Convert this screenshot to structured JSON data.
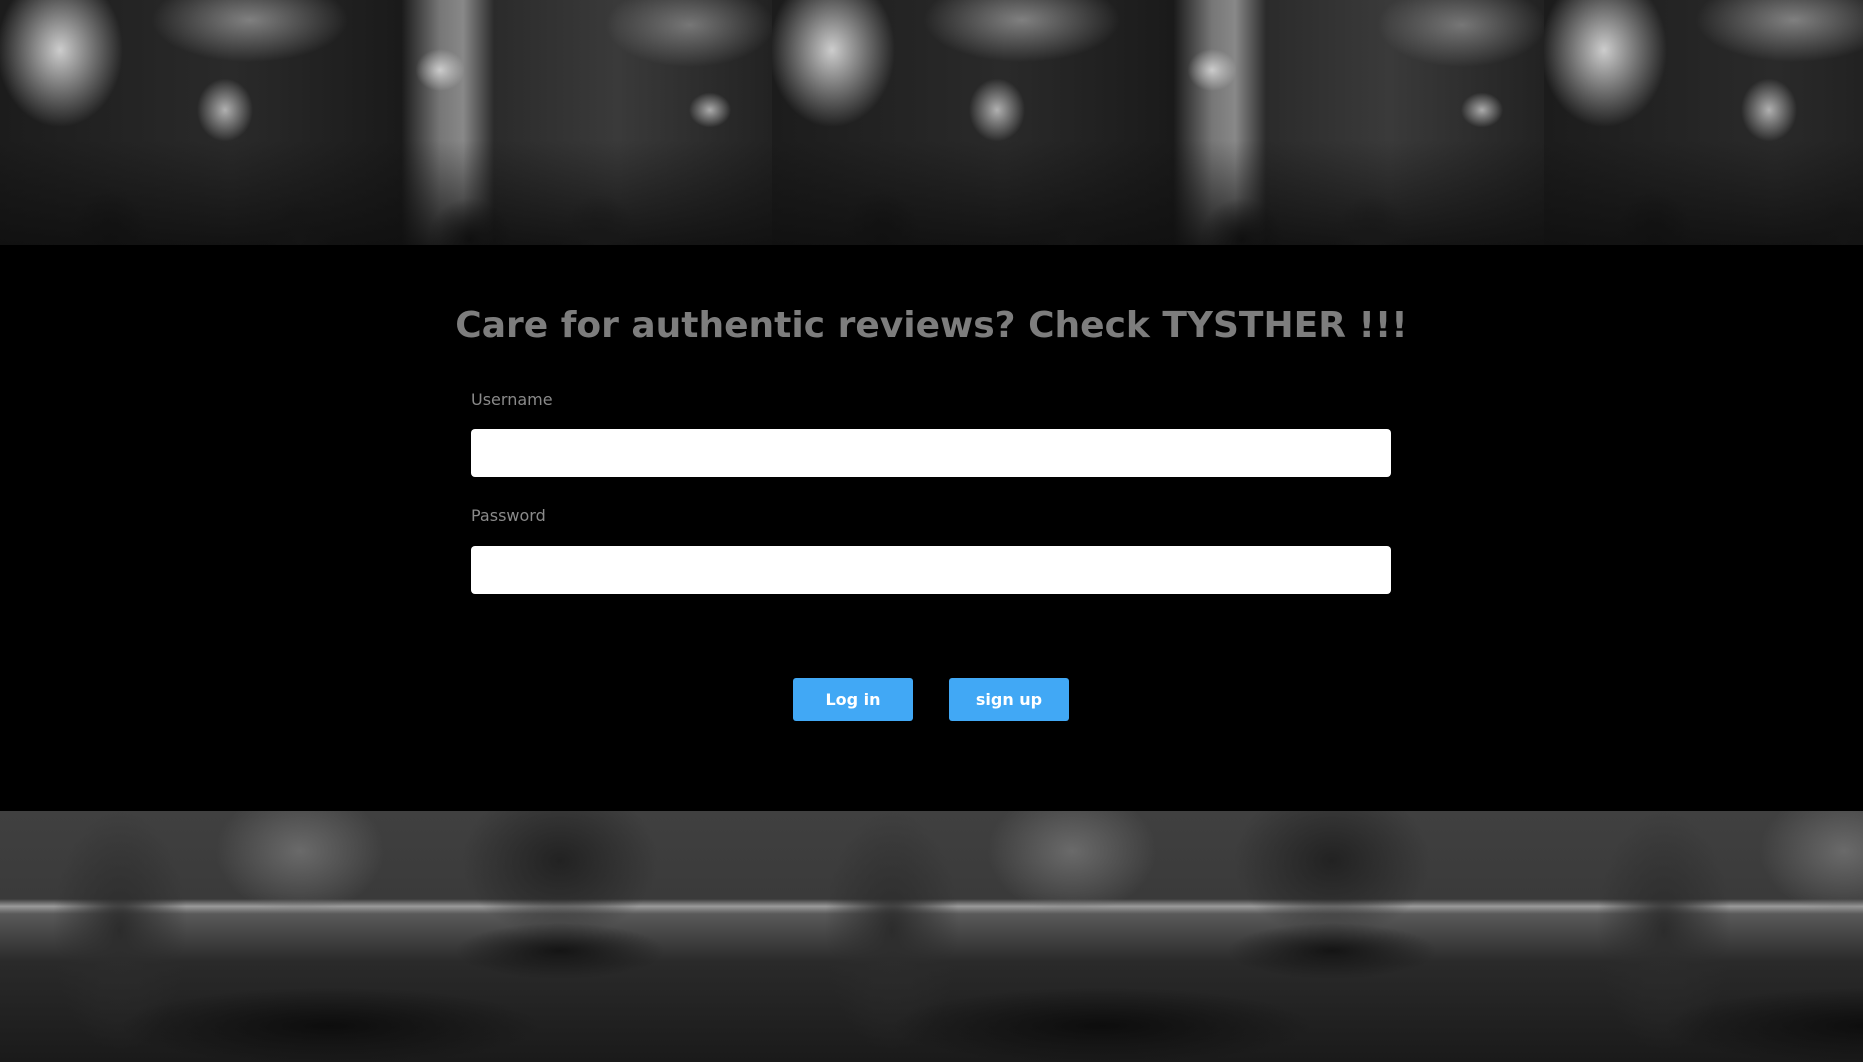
{
  "header": {
    "title": "Care for authentic reviews? Check TYSTHER !!!"
  },
  "login_form": {
    "username_label": "Username",
    "username_value": "",
    "password_label": "Password",
    "password_value": "",
    "login_label": "Log in",
    "signup_label": "sign up"
  },
  "colors": {
    "background": "#000000",
    "headline_text": "#7d7d7d",
    "label_text": "#8a8a8a",
    "button_accent": "#41a8f5",
    "button_text": "#ffffff",
    "input_background": "#ffffff"
  },
  "images": {
    "top_banner": "restaurant-interior-photo",
    "bottom_banner": "restaurant-tables-photo"
  }
}
